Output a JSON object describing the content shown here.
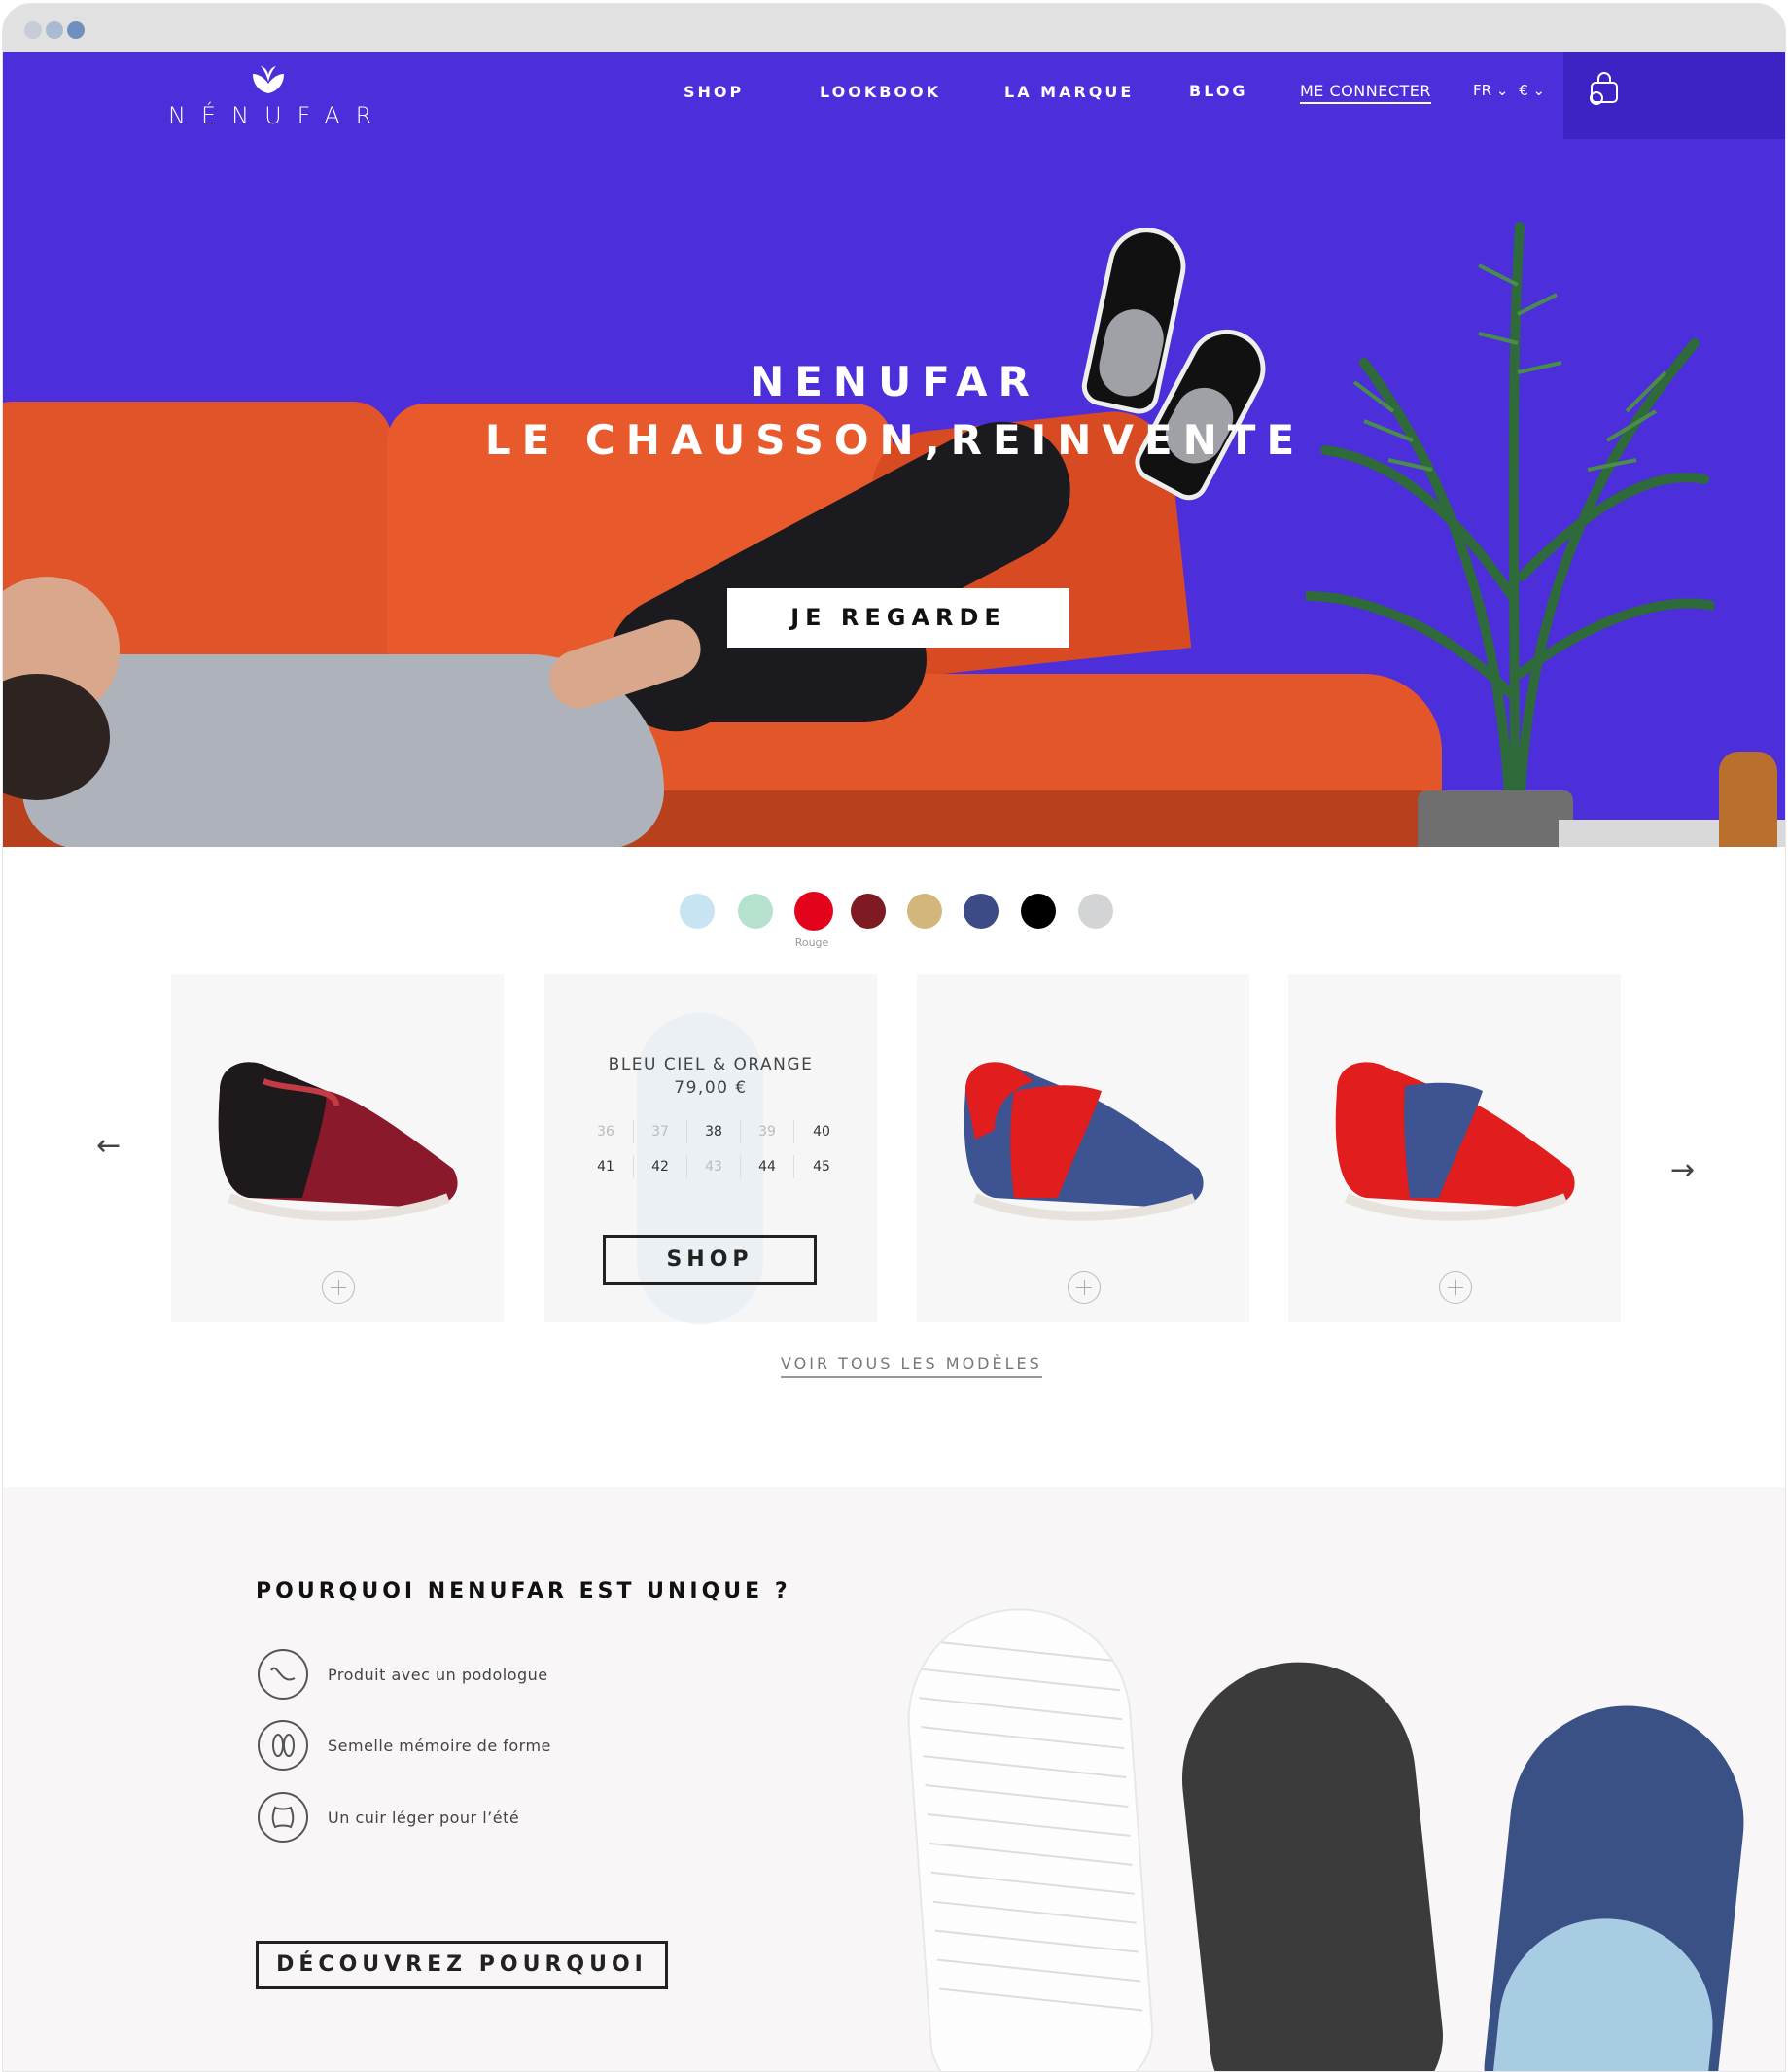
{
  "browser": {
    "dots": [
      "#c7cdd6",
      "#a9bbd2",
      "#6f90bf"
    ]
  },
  "header": {
    "logo_text": "NÉNUFAR",
    "nav": [
      "SHOP",
      "LOOKBOOK",
      "LA MARQUE",
      "BLOG"
    ],
    "login": "ME CONNECTER",
    "lang": "FR",
    "currency": "€",
    "cart_icon": "shopping-bag-icon"
  },
  "hero": {
    "title_line1": "NENUFAR",
    "title_line2": "LE CHAUSSON,REINVENTE",
    "cta": "JE REGARDE",
    "background_color": "#4c2edb"
  },
  "colors": {
    "swatches": [
      "#c6e4f2",
      "#b6e2cd",
      "#e3041b",
      "#7e1a22",
      "#d3b77a",
      "#3c4a85",
      "#000000",
      "#d2d4d6"
    ],
    "selected_label": "Rouge",
    "selected_index": 2
  },
  "products": {
    "hover_card": {
      "name": "BLEU CIEL & ORANGE",
      "price": "79,00 €",
      "sizes_row1": [
        "36",
        "37",
        "38",
        "39",
        "40"
      ],
      "sizes_row2": [
        "41",
        "42",
        "43",
        "44",
        "45"
      ],
      "unavailable": [
        "36",
        "37",
        "39",
        "43"
      ],
      "shop": "SHOP"
    },
    "see_all": "VOIR TOUS LES MODÈLES",
    "prev_icon": "arrow-left-icon",
    "next_icon": "arrow-right-icon"
  },
  "unique": {
    "title": "POURQUOI NENUFAR EST UNIQUE ?",
    "features": [
      {
        "icon": "curve-icon",
        "text": "Produit avec un podologue"
      },
      {
        "icon": "footprint-icon",
        "text": "Semelle mémoire de forme"
      },
      {
        "icon": "leather-icon",
        "text": "Un cuir léger pour l’été"
      }
    ],
    "cta": "DÉCOUVREZ POURQUOI"
  }
}
